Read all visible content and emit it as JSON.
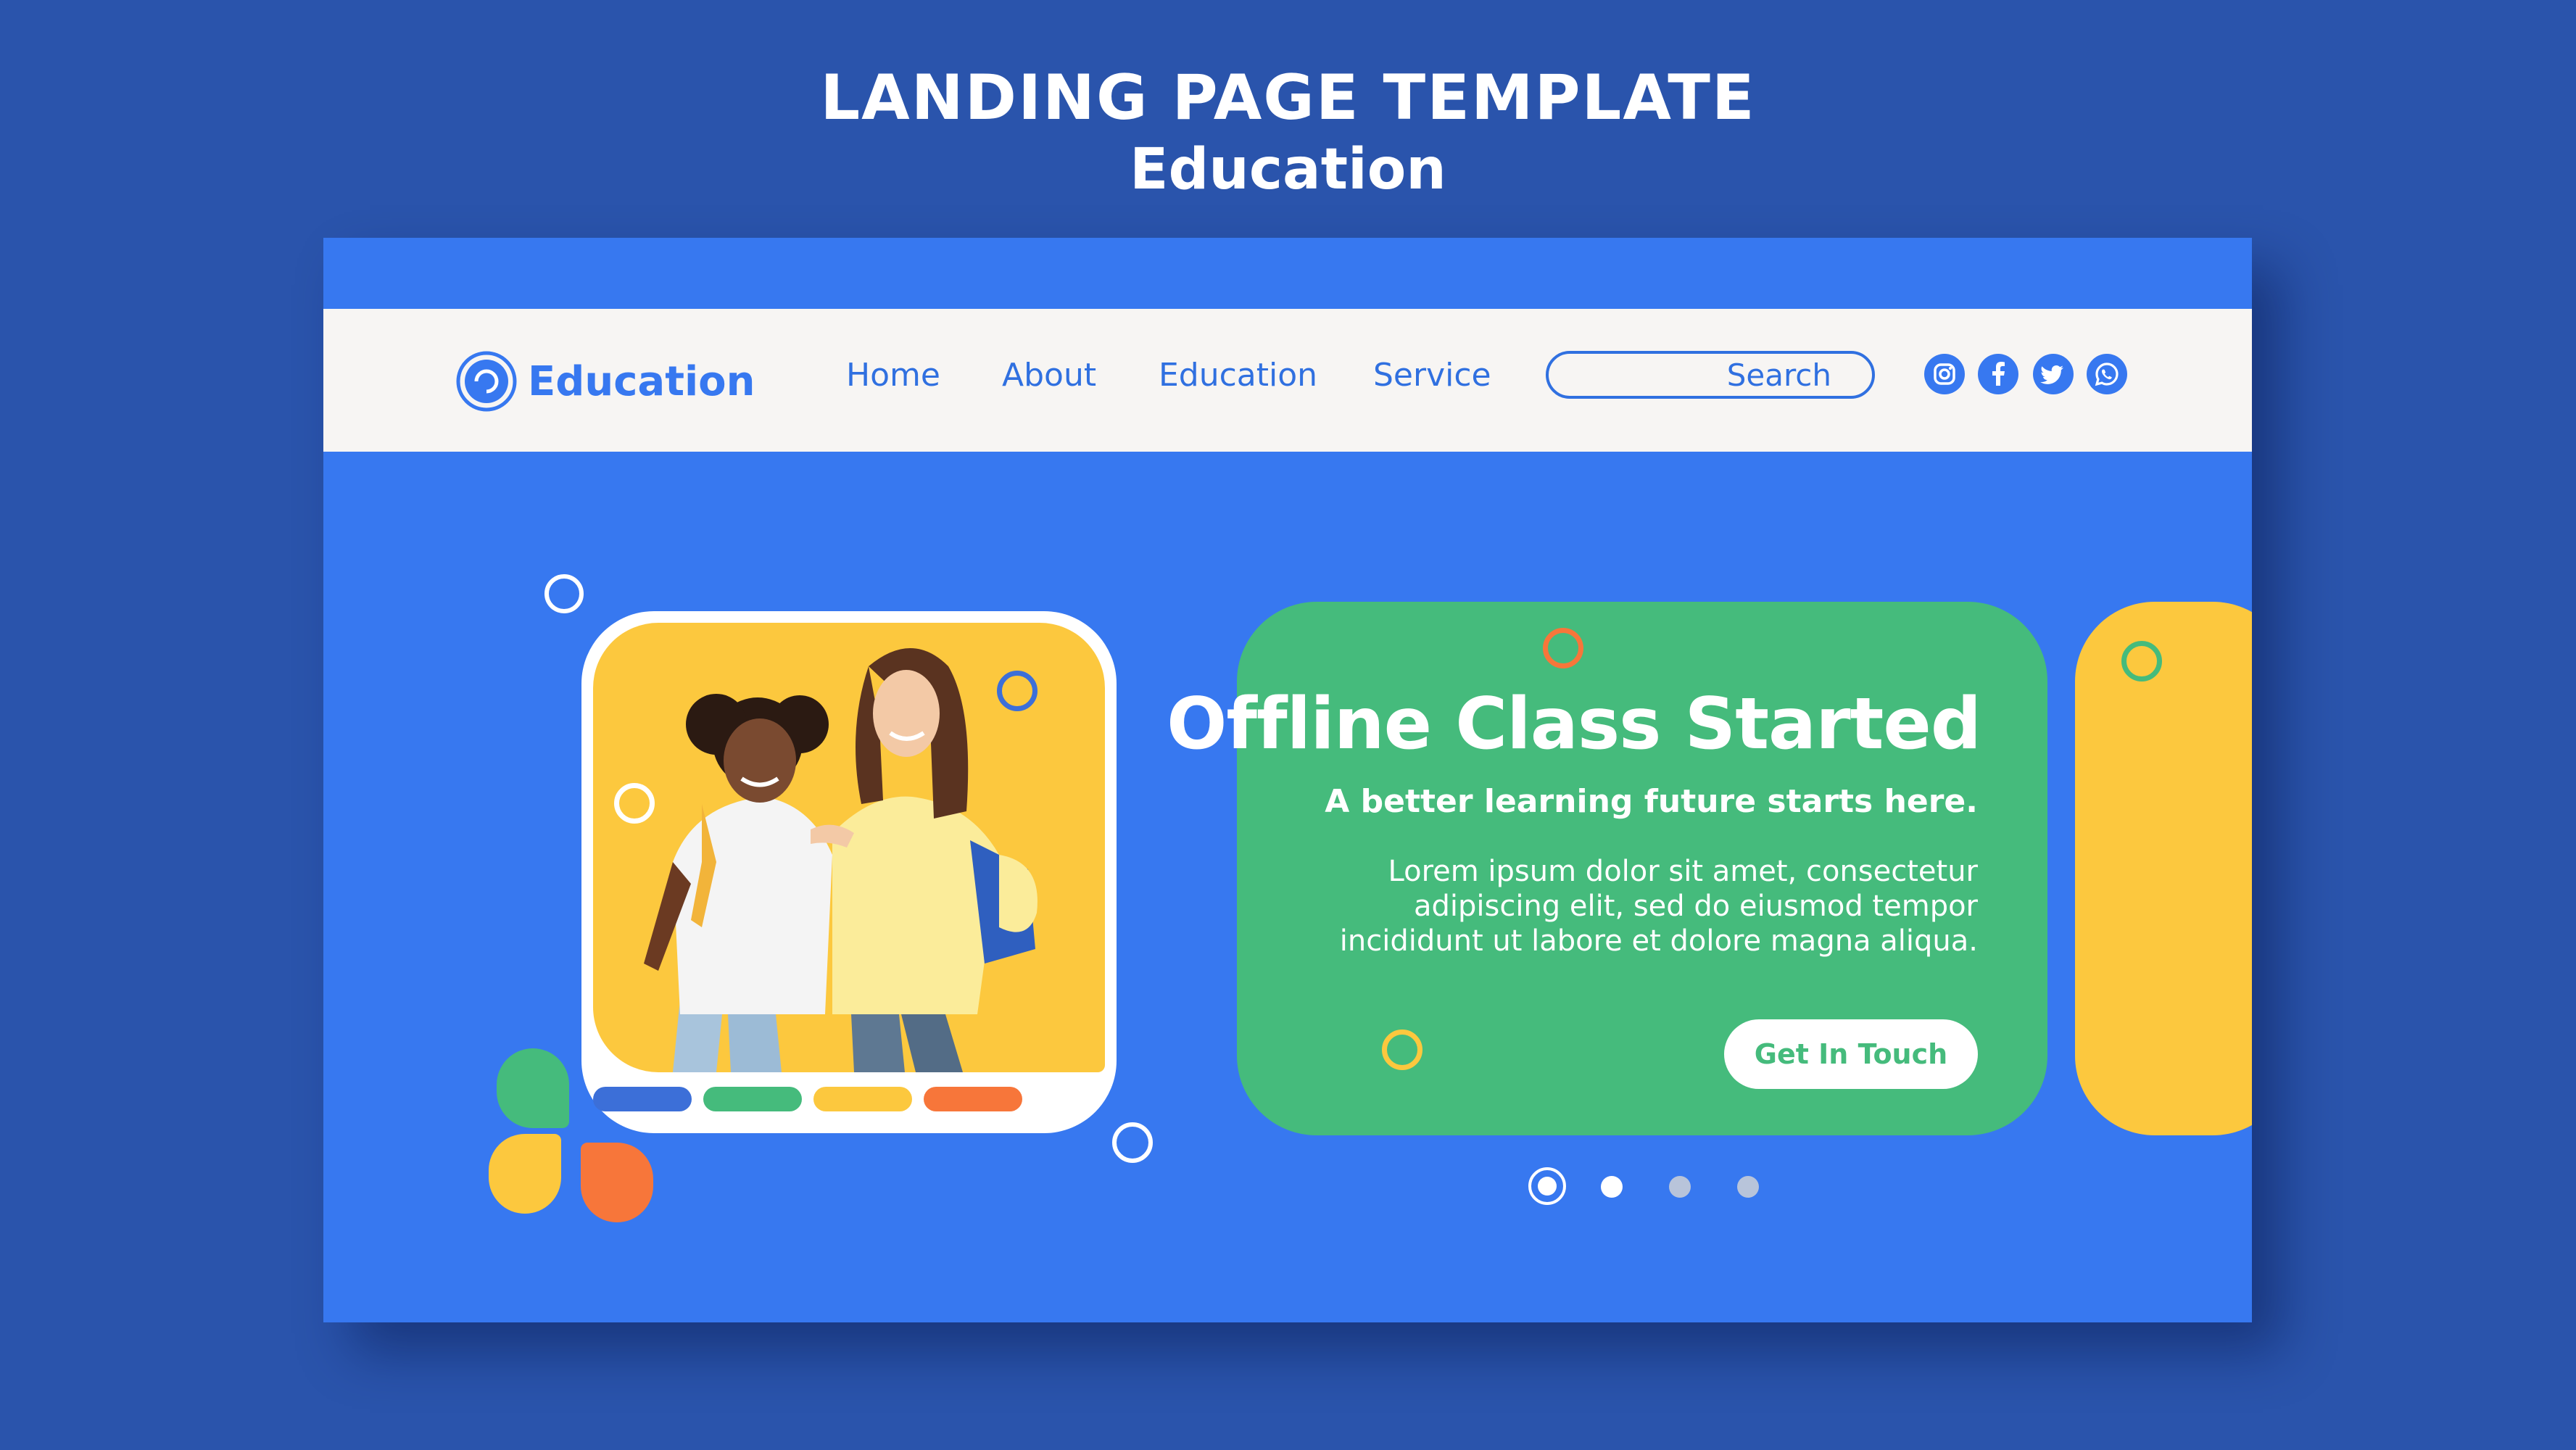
{
  "heading": {
    "title": "LANDING PAGE TEMPLATE",
    "subtitle": "Education"
  },
  "navbar": {
    "brand": "Education",
    "links": [
      "Home",
      "About",
      "Education",
      "Service"
    ],
    "search_placeholder": "Search",
    "social_icons": [
      "instagram-icon",
      "facebook-icon",
      "twitter-icon",
      "whatsapp-icon"
    ]
  },
  "hero": {
    "title": "Offline Class Started",
    "subtitle": "A better learning future starts here.",
    "body": "Lorem ipsum dolor sit amet, consectetur adipiscing elit, sed do eiusmod tempor incididunt ut labore et dolore magna aliqua.",
    "cta_label": "Get In Touch"
  },
  "carousel": {
    "slide_count": 4,
    "active_index": 0
  },
  "colors": {
    "page_background": "#2a54ac",
    "mockup_background": "#3778f0",
    "navbar_background": "#f7f5f3",
    "green": "#45bb7c",
    "yellow": "#fcc83e",
    "orange": "#f7763a",
    "blue": "#3c6fd8",
    "white": "#ffffff"
  }
}
